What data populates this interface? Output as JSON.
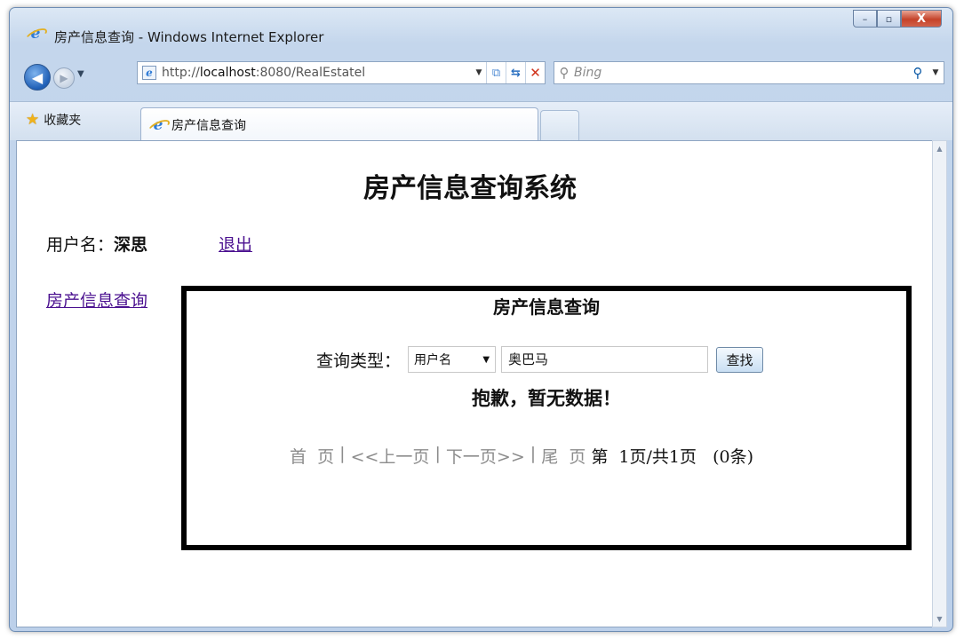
{
  "window": {
    "title": "房产信息查询 - Windows Internet Explorer",
    "controls": {
      "minimize": "–",
      "maximize": "▫",
      "close": "X"
    }
  },
  "navbar": {
    "url_prefix": "http://",
    "url_host": "localhost",
    "url_rest": ":8080/RealEstatel",
    "search_placeholder": "Bing"
  },
  "tabs": {
    "favorites_label": "收藏夹",
    "active_tab_label": "房产信息查询"
  },
  "page": {
    "title": "房产信息查询系统",
    "user_label": "用户名：",
    "username": "深思",
    "logout_label": "退出",
    "nav_link_label": "房产信息查询"
  },
  "panel": {
    "title": "房产信息查询",
    "query_type_label": "查询类型：",
    "query_type_selected": "用户名",
    "query_value": "奥巴马",
    "search_button_label": "查找",
    "empty_message": "抱歉，暂无数据！",
    "pager": {
      "first": "首  页",
      "sep": " | ",
      "prev": "<<上一页",
      "next": "下一页>>",
      "last": "尾  页",
      "info": "第  1页/共1页   (0条)"
    }
  }
}
